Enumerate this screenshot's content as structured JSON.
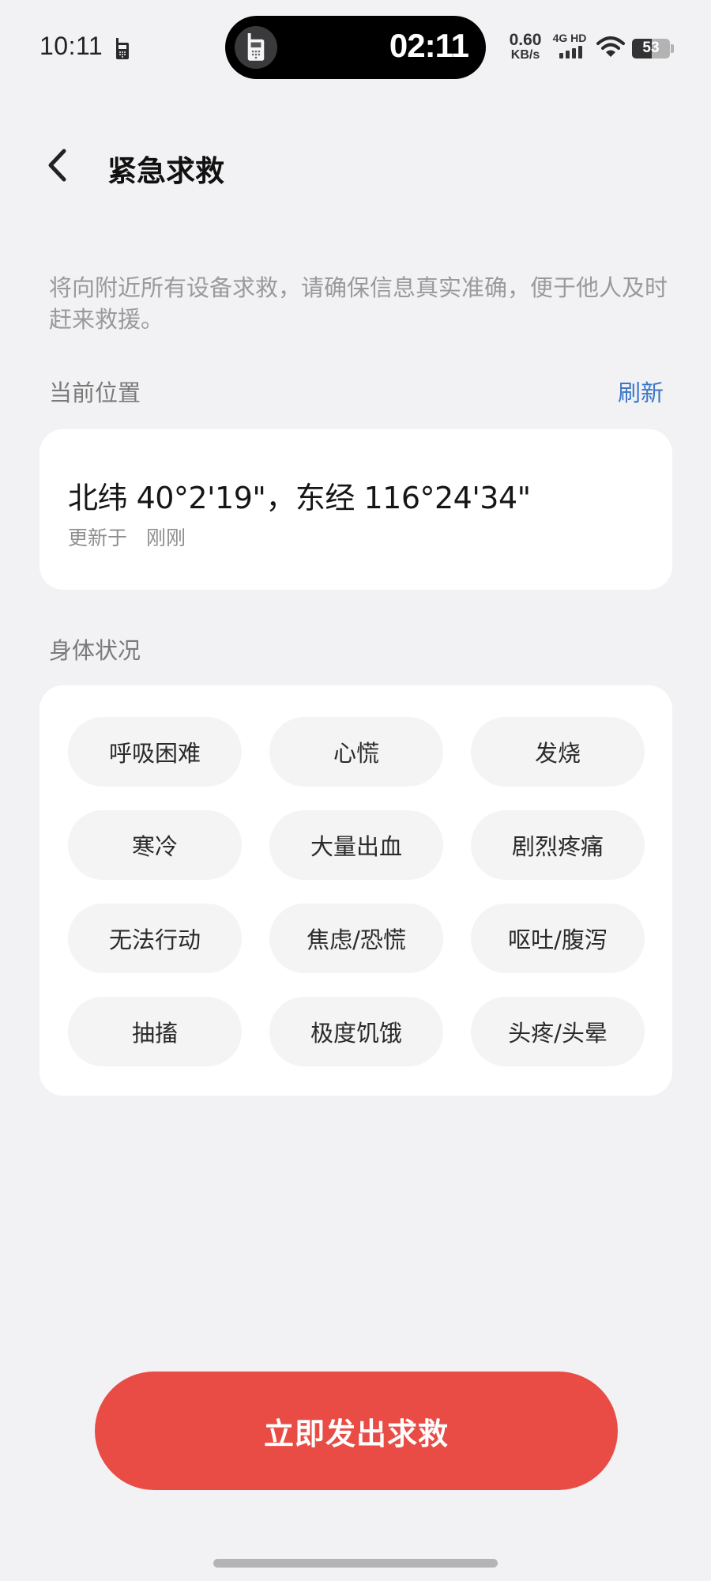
{
  "status_bar": {
    "time": "10:11",
    "island_time": "02:11",
    "net_speed_value": "0.60",
    "net_speed_unit": "KB/s",
    "network_type": "4G HD",
    "signal_level": 4,
    "battery_percent": "53",
    "battery_level": 0.53,
    "icons": [
      "phone-call-icon",
      "signal-icon",
      "wifi-icon",
      "battery-icon"
    ]
  },
  "header": {
    "back_icon": "chevron-left-icon",
    "title": "紧急求救"
  },
  "description": "将向附近所有设备求救，请确保信息真实准确，便于他人及时赶来救援。",
  "location": {
    "label": "当前位置",
    "refresh_label": "刷新",
    "coordinates": "北纬 40°2'19\"，东经 116°24'34\"",
    "updated_prefix": "更新于",
    "updated_value": "刚刚"
  },
  "condition": {
    "label": "身体状况",
    "options": [
      "呼吸困难",
      "心慌",
      "发烧",
      "寒冷",
      "大量出血",
      "剧烈疼痛",
      "无法行动",
      "焦虑/恐慌",
      "呕吐/腹泻",
      "抽搐",
      "极度饥饿",
      "头疼/头晕"
    ]
  },
  "colors": {
    "accent_link": "#3a76c9",
    "sos_button": "#e84c45",
    "background": "#f2f2f4"
  },
  "sos_button_label": "立即发出求救"
}
